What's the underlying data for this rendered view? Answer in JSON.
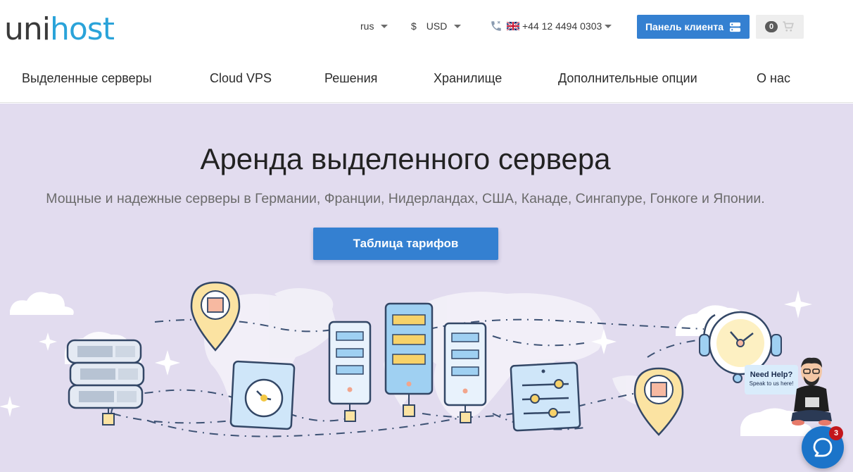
{
  "brand": {
    "part1": "uni",
    "part2": "host"
  },
  "header": {
    "language": "rus",
    "currency_symbol": "$",
    "currency": "USD",
    "phone": "+44 12 4494 0303",
    "client_panel_label": "Панель клиента",
    "cart_count": "0"
  },
  "nav": {
    "items": [
      {
        "label": "Выделенные серверы"
      },
      {
        "label": "Cloud VPS"
      },
      {
        "label": "Решения"
      },
      {
        "label": "Хранилище"
      },
      {
        "label": "Дополнительные опции"
      },
      {
        "label": "О нас"
      }
    ]
  },
  "hero": {
    "title": "Аренда выделенного сервера",
    "subtitle": "Мощные и надежные серверы в Германии, Франции, Нидерландах, США, Канаде, Сингапуре, Гонкоге и Японии.",
    "cta_label": "Таблица тарифов"
  },
  "chat": {
    "help_title": "Need Help?",
    "help_subtitle": "Speak to us here!",
    "unread_count": "3"
  },
  "colors": {
    "brand_blue": "#3480d1",
    "logo_accent": "#2aa3d9",
    "hero_background": "#e2dcef",
    "chat_blue": "#1b74c9",
    "badge_red": "#c3161c"
  }
}
